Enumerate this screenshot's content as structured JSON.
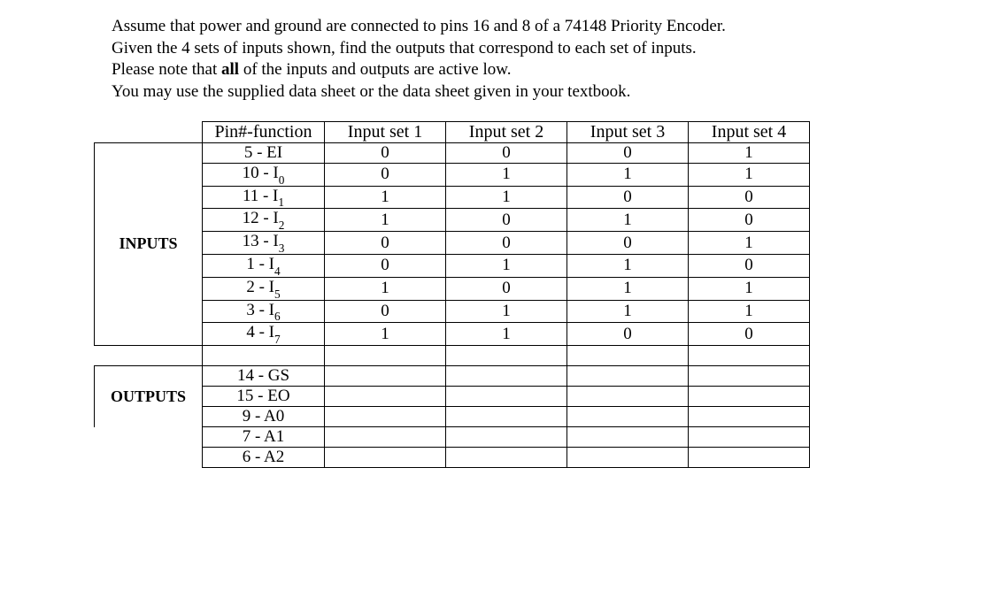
{
  "intro": {
    "line1": "Assume that power and ground are connected to pins 16 and 8 of a 74148 Priority Encoder.",
    "line2": "Given the 4 sets of inputs shown, find the outputs that correspond to each set of inputs.",
    "line3_prefix": "Please note that ",
    "line3_bold": "all",
    "line3_suffix": " of the inputs and outputs are active low.",
    "line4": "You may use the supplied data sheet or the data sheet given in your textbook."
  },
  "headers": {
    "pin": "Pin#-function",
    "set1": "Input set 1",
    "set2": "Input set 2",
    "set3": "Input set 3",
    "set4": "Input set 4"
  },
  "section_inputs": "INPUTS",
  "section_outputs": "OUTPUTS",
  "inputs": [
    {
      "pin": "5  -  EI",
      "s1": "0",
      "s2": "0",
      "s3": "0",
      "s4": "1"
    },
    {
      "pin": "10  -  I",
      "sub": "0",
      "s1": "0",
      "s2": "1",
      "s3": "1",
      "s4": "1"
    },
    {
      "pin": "11  -  I",
      "sub": "1",
      "s1": "1",
      "s2": "1",
      "s3": "0",
      "s4": "0"
    },
    {
      "pin": "12  -  I",
      "sub": "2",
      "s1": "1",
      "s2": "0",
      "s3": "1",
      "s4": "0"
    },
    {
      "pin": "13  -  I",
      "sub": "3",
      "s1": "0",
      "s2": "0",
      "s3": "0",
      "s4": "1"
    },
    {
      "pin": "1 -   I",
      "sub": "4",
      "s1": "0",
      "s2": "1",
      "s3": "1",
      "s4": "0"
    },
    {
      "pin": "2  -   I",
      "sub": "5",
      "s1": "1",
      "s2": "0",
      "s3": "1",
      "s4": "1"
    },
    {
      "pin": "3  -   I",
      "sub": "6",
      "s1": "0",
      "s2": "1",
      "s3": "1",
      "s4": "1"
    },
    {
      "pin": "4  -   I",
      "sub": "7",
      "s1": "1",
      "s2": "1",
      "s3": "0",
      "s4": "0"
    }
  ],
  "outputs": [
    {
      "pin": "14  -   GS",
      "s1": "",
      "s2": "",
      "s3": "",
      "s4": ""
    },
    {
      "pin": "15  -   EO",
      "s1": "",
      "s2": "",
      "s3": "",
      "s4": ""
    },
    {
      "pin": "9  -  A0",
      "s1": "",
      "s2": "",
      "s3": "",
      "s4": ""
    },
    {
      "pin": "7  -  A1",
      "s1": "",
      "s2": "",
      "s3": "",
      "s4": ""
    },
    {
      "pin": "6  - A2",
      "s1": "",
      "s2": "",
      "s3": "",
      "s4": ""
    }
  ]
}
